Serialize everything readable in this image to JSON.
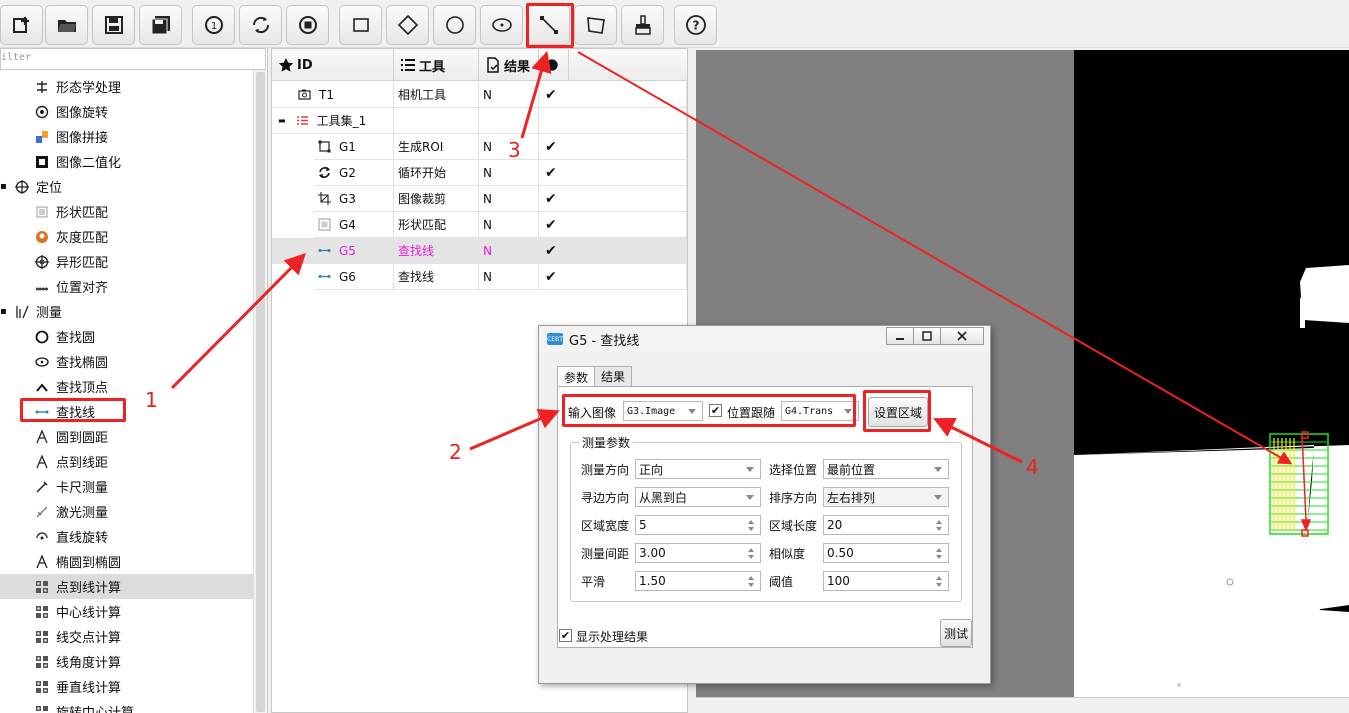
{
  "toolbar": {
    "buttons": [
      "add-icon",
      "open-folder-icon",
      "save-icon",
      "save-as-icon",
      "run-once-icon",
      "run-loop-icon",
      "stop-icon",
      "rectangle-roi-icon",
      "rotated-rect-roi-icon",
      "circle-roi-icon",
      "ellipse-roi-icon",
      "line-roi-icon",
      "polygon-roi-icon",
      "clear-roi-icon",
      "help-icon"
    ]
  },
  "left_tree": {
    "filter_placeholder": "ilter",
    "items": [
      {
        "label": "形态学处理",
        "icon": "morphology-icon"
      },
      {
        "label": "图像旋转",
        "icon": "rotate-image-icon"
      },
      {
        "label": "图像拼接",
        "icon": "stitch-icon"
      },
      {
        "label": "图像二值化",
        "icon": "binarize-icon"
      },
      {
        "label": "定位",
        "icon": "locate-icon",
        "category": true
      },
      {
        "label": "形状匹配",
        "icon": "shape-match-icon"
      },
      {
        "label": "灰度匹配",
        "icon": "gray-match-icon"
      },
      {
        "label": "异形匹配",
        "icon": "special-match-icon"
      },
      {
        "label": "位置对齐",
        "icon": "align-icon"
      },
      {
        "label": "测量",
        "icon": "measure-icon",
        "category": true
      },
      {
        "label": "查找圆",
        "icon": "find-circle-icon"
      },
      {
        "label": "查找椭圆",
        "icon": "find-ellipse-icon"
      },
      {
        "label": "查找顶点",
        "icon": "find-vertex-icon"
      },
      {
        "label": "查找线",
        "icon": "find-line-icon"
      },
      {
        "label": "圆到圆距",
        "icon": "circle-distance-icon"
      },
      {
        "label": "点到线距",
        "icon": "point-line-distance-icon"
      },
      {
        "label": "卡尺测量",
        "icon": "caliper-icon"
      },
      {
        "label": "激光测量",
        "icon": "laser-icon"
      },
      {
        "label": "直线旋转",
        "icon": "line-rotate-icon"
      },
      {
        "label": "椭圆到椭圆",
        "icon": "ellipse-distance-icon"
      },
      {
        "label": "点到线计算",
        "icon": "calc-icon"
      },
      {
        "label": "中心线计算",
        "icon": "calc-icon"
      },
      {
        "label": "线交点计算",
        "icon": "calc-icon"
      },
      {
        "label": "线角度计算",
        "icon": "calc-icon"
      },
      {
        "label": "垂直线计算",
        "icon": "calc-icon"
      },
      {
        "label": "旋转中心计算",
        "icon": "calc-icon"
      }
    ]
  },
  "table": {
    "headers": [
      "ID",
      "工具",
      "结果",
      ""
    ],
    "rows": [
      {
        "id": "T1",
        "tool": "相机工具",
        "result": "N",
        "checked": "✔",
        "icon": "camera-icon"
      },
      {
        "id": "工具集_1",
        "tool": "",
        "result": "",
        "checked": "",
        "icon": "toolset-icon"
      },
      {
        "id": "G1",
        "tool": "生成ROI",
        "result": "N",
        "checked": "✔",
        "icon": "roi-icon"
      },
      {
        "id": "G2",
        "tool": "循环开始",
        "result": "N",
        "checked": "✔",
        "icon": "loop-icon"
      },
      {
        "id": "G3",
        "tool": "图像裁剪",
        "result": "N",
        "checked": "✔",
        "icon": "crop-icon"
      },
      {
        "id": "G4",
        "tool": "形状匹配",
        "result": "N",
        "checked": "✔",
        "icon": "shape-match-icon"
      },
      {
        "id": "G5",
        "tool": "查找线",
        "result": "N",
        "checked": "✔",
        "icon": "find-line-icon"
      },
      {
        "id": "G6",
        "tool": "查找线",
        "result": "N",
        "checked": "✔",
        "icon": "find-line-icon"
      }
    ]
  },
  "dialog": {
    "title": "G5 - 查找线",
    "logo_text": "CEBT",
    "tabs": [
      "参数",
      "结果"
    ],
    "input_image_label": "输入图像",
    "input_image_value": "G3.Image",
    "follow_label": "位置跟随",
    "follow_value": "G4.Trans",
    "set_region_button": "设置区域",
    "group_title": "测量参数",
    "params": {
      "direction_label": "测量方向",
      "direction_value": "正向",
      "select_pos_label": "选择位置",
      "select_pos_value": "最前位置",
      "edge_dir_label": "寻边方向",
      "edge_dir_value": "从黑到白",
      "sort_dir_label": "排序方向",
      "sort_dir_value": "左右排列",
      "width_label": "区域宽度",
      "width_value": "5",
      "length_label": "区域长度",
      "length_value": "20",
      "spacing_label": "测量间距",
      "spacing_value": "3.00",
      "similarity_label": "相似度",
      "similarity_value": "0.50",
      "smooth_label": "平滑",
      "smooth_value": "1.50",
      "threshold_label": "阈值",
      "threshold_value": "100"
    },
    "show_result_label": "显示处理结果",
    "test_button": "测试"
  },
  "annotations": {
    "n1": "1",
    "n2": "2",
    "n3": "3",
    "n4": "4"
  },
  "colors": {
    "annotation_red": "#ee2222",
    "selected_row_text": "#e020e0",
    "roi_green": "#22dd22",
    "roi_yellow": "#eeee00"
  }
}
